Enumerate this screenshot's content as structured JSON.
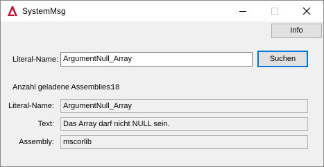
{
  "window": {
    "title": "SystemMsg",
    "icon": "autocad-a-icon",
    "accent_color": "#c8102e"
  },
  "toolbar": {
    "info_label": "Info"
  },
  "search": {
    "literal_label": "Literal-Name:",
    "literal_value": "ArgumentNull_Array",
    "search_button_label": "Suchen"
  },
  "summary": {
    "assemblies_label": "Anzahl geladene Assemblies:",
    "assemblies_count": "18"
  },
  "result": {
    "literal_label": "Literal-Name:",
    "literal_value": "ArgumentNull_Array",
    "text_label": "Text:",
    "text_value": "Das Array darf nicht NULL sein.",
    "assembly_label": "Assembly:",
    "assembly_value": "mscorlib"
  }
}
